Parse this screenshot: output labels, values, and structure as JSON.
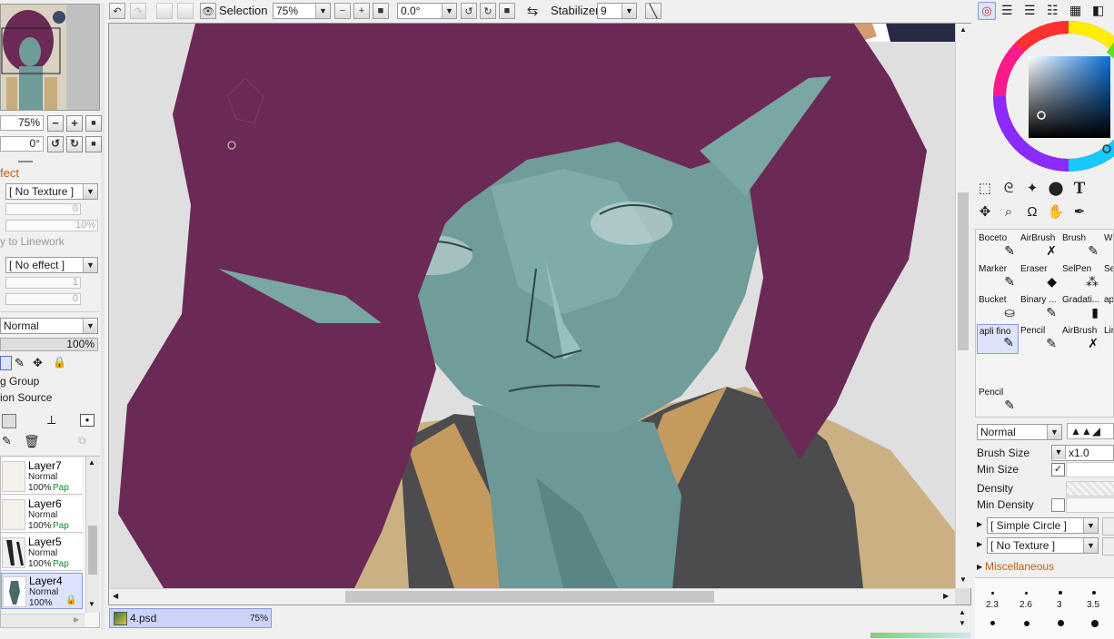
{
  "toolbar": {
    "selection_label": "Selection",
    "zoom_value": "75%",
    "rotation_value": "0.0°",
    "stabilizer_label": "Stabilizer",
    "stabilizer_value": "9"
  },
  "left_panel": {
    "zoom_value": "75%",
    "rotation_value": "0°",
    "effect_header": "fect",
    "texture_combo": "[ No Texture ]",
    "texture_slider_1": "0",
    "texture_slider_2": "10%",
    "apply_linework_label": "y to Linework",
    "effect_combo": "[ No effect ]",
    "effect_slider_1": "1",
    "effect_slider_2": "0",
    "blend_mode": "Normal",
    "opacity": "100%",
    "clipping_group_label": "g Group",
    "selection_source_label": "ion Source"
  },
  "layers": [
    {
      "name": "Layer7",
      "mode": "Normal",
      "opacity": "100%",
      "tag": "Pap"
    },
    {
      "name": "Layer6",
      "mode": "Normal",
      "opacity": "100%",
      "tag": "Pap"
    },
    {
      "name": "Layer5",
      "mode": "Normal",
      "opacity": "100%",
      "tag": "Pap"
    },
    {
      "name": "Layer4",
      "mode": "Normal",
      "opacity": "100%",
      "tag": ""
    }
  ],
  "doc_tab": {
    "name": "4.psd",
    "zoom": "75%"
  },
  "brushes": [
    {
      "label": "Boceto"
    },
    {
      "label": "AirBrush"
    },
    {
      "label": "Brush"
    },
    {
      "label": "W"
    },
    {
      "label": "Marker"
    },
    {
      "label": "Eraser"
    },
    {
      "label": "SelPen"
    },
    {
      "label": "Se"
    },
    {
      "label": "Bucket"
    },
    {
      "label": "Binary ..."
    },
    {
      "label": "Gradati..."
    },
    {
      "label": "ap"
    },
    {
      "label": "apli fino"
    },
    {
      "label": "Pencil"
    },
    {
      "label": "AirBrush"
    },
    {
      "label": "Lir"
    },
    {
      "label": "Pencil"
    }
  ],
  "brush_settings": {
    "blend_mode": "Normal",
    "brush_size_label": "Brush Size",
    "brush_size_mult": "x1.0",
    "min_size_label": "Min Size",
    "density_label": "Density",
    "min_density_label": "Min Density",
    "shape_combo": "[ Simple Circle ]",
    "texture_combo": "[ No Texture ]",
    "misc_label": "Miscellaneous",
    "sizes": [
      "2.3",
      "2.6",
      "3",
      "3.5"
    ]
  },
  "colors": {
    "hair": "#6b2a55",
    "skin": "#6f9b99",
    "shirt": "#c8ad7c",
    "accent": "#8a98e6"
  }
}
